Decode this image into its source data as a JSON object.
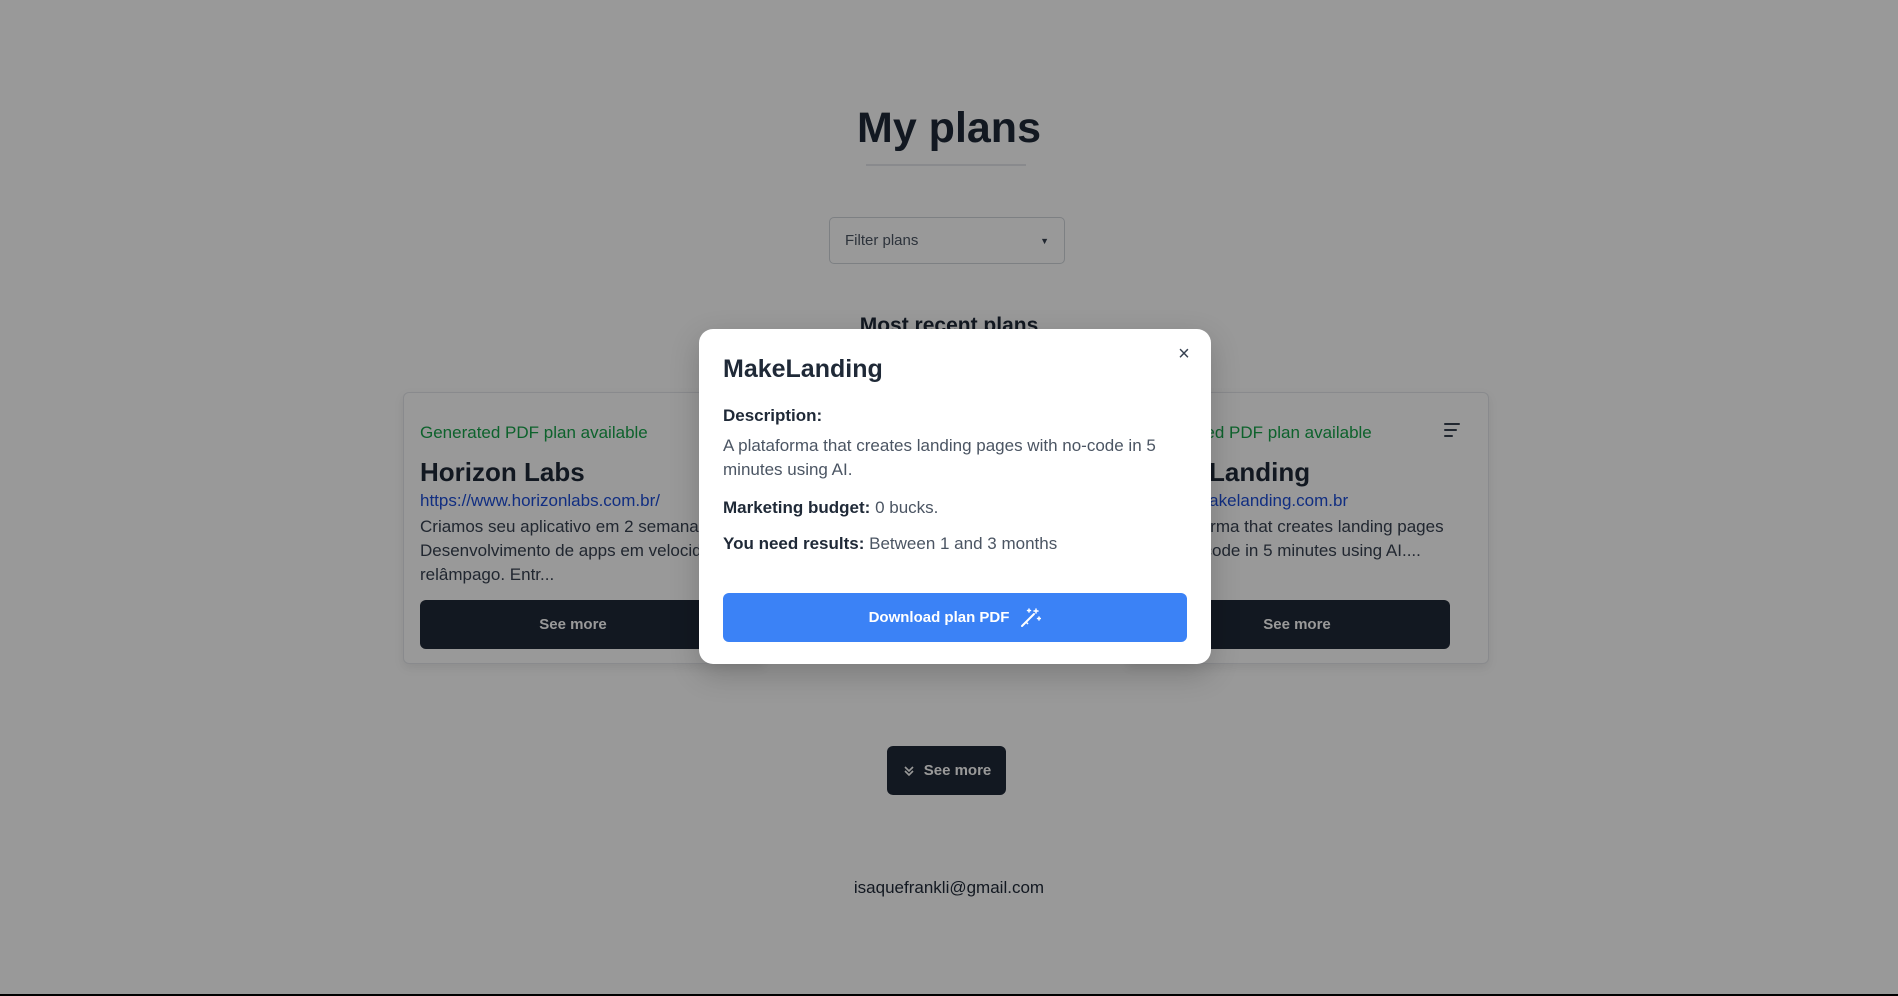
{
  "page": {
    "title": "My plans",
    "filter_placeholder": "Filter plans",
    "section_heading": "Most recent plans",
    "see_more_label": "See more",
    "footer_email": "isaquefrankli@gmail.com"
  },
  "cards": [
    {
      "status": "Generated PDF plan available",
      "name": "Horizon Labs",
      "url": "https://www.horizonlabs.com.br/",
      "description": "Criamos seu aplicativo em 2 semanas Desenvolvimento de apps em velocidade relâmpago. Entr...",
      "button": "See more"
    },
    {
      "status": "Generated PDF plan available",
      "name": "MakeLanding",
      "url": "https://makelanding.com.br",
      "description": "A plataforma that creates landing pages with no-code in 5 minutes using AI....",
      "button": "See more"
    }
  ],
  "modal": {
    "title": "MakeLanding",
    "description_label": "Description:",
    "description": "A plataforma that creates landing pages with no-code in 5 minutes using AI.",
    "budget_label": "Marketing budget:",
    "budget_value": "0 bucks.",
    "results_label": "You need results:",
    "results_value": "Between 1 and 3 months",
    "download_label": "Download plan PDF",
    "close_icon": "×"
  },
  "colors": {
    "status_green": "#16a34a",
    "link_blue": "#1d4ed8",
    "primary_blue": "#3b82f6",
    "dark_button": "#1f2937"
  }
}
